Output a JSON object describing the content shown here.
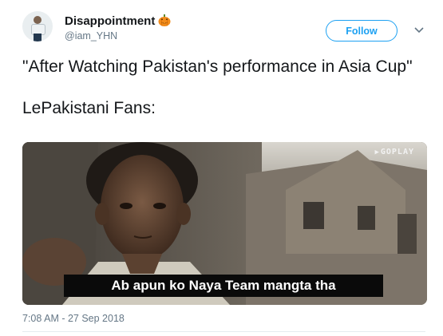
{
  "user": {
    "display_name": "Disappointment",
    "handle": "@iam_YHN",
    "name_emoji": "jack-o-lantern-icon"
  },
  "actions": {
    "follow_label": "Follow",
    "more_icon": "chevron-down-icon"
  },
  "tweet": {
    "text_line1": "\"After Watching Pakistan's performance in Asia Cup\"",
    "text_line2": "LePakistani Fans:"
  },
  "media": {
    "watermark": "GOPLAY",
    "caption": "Ab apun ko Naya Team mangta tha"
  },
  "meta": {
    "timestamp": "7:08 AM - 27 Sep 2018"
  },
  "colors": {
    "accent": "#1da1f2",
    "text_primary": "#14171a",
    "text_secondary": "#657786"
  }
}
